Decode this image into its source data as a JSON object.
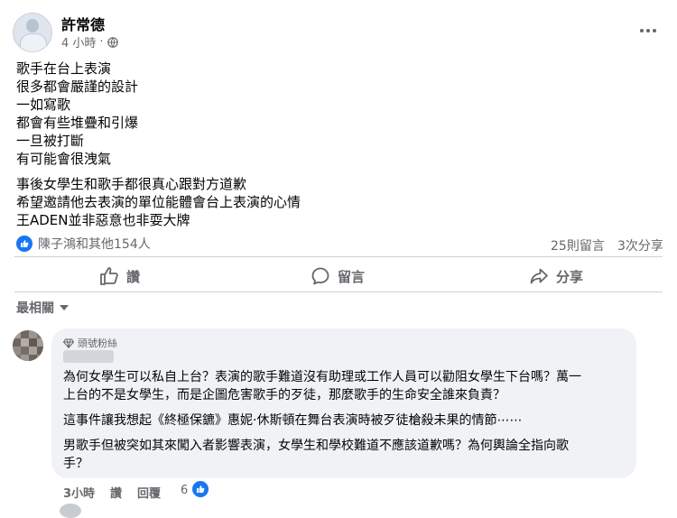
{
  "post": {
    "author": "許常德",
    "time": "4 小時",
    "lines": [
      "歌手在台上表演",
      "很多都會嚴謹的設計",
      "一如寫歌",
      "都會有些堆疊和引爆",
      "一旦被打斷",
      "有可能會很洩氣",
      "事後女學生和歌手都很真心跟對方道歉",
      "希望邀請他去表演的單位能體會台上表演的心情",
      "王ADEN並非惡意也非耍大牌"
    ],
    "reactions_text": "陳子鴻和其他154人",
    "comments_count": "25則留言",
    "shares_count": "3次分享"
  },
  "actions": {
    "like": "讚",
    "comment": "留言",
    "share": "分享"
  },
  "sort_label": "最相關",
  "comment": {
    "badge": "頭號粉絲",
    "paragraphs": [
      "為何女學生可以私自上台？表演的歌手難道沒有助理或工作人員可以勸阻女學生下台嗎？萬一",
      "上台的不是女學生，而是企圖危害歌手的歹徒，那麼歌手的生命安全誰來負責？",
      "這事件讓我想起《終極保鑣》惠妮·休斯頓在舞台表演時被歹徒槍殺未果的情節⋯⋯",
      "男歌手但被突如其來闖入者影響表演，女學生和學校難道不應該道歉嗎？為何輿論全指向歌",
      "手？"
    ],
    "time": "3小時",
    "like_label": "讚",
    "reply_label": "回覆",
    "like_count": "6"
  },
  "colors": {
    "accent": "#1877f2",
    "secondary_text": "#65676b",
    "bubble": "#f0f2f5"
  }
}
